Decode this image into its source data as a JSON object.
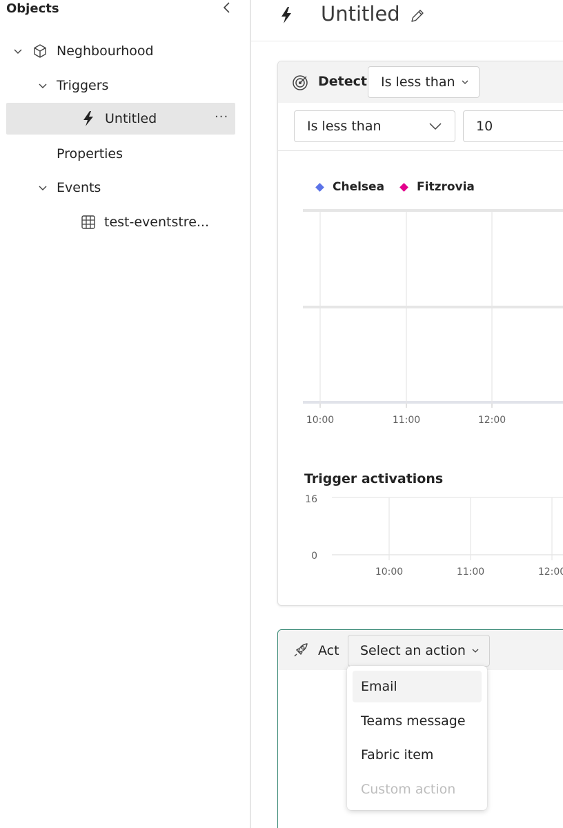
{
  "sidebar": {
    "title": "Objects",
    "tree": [
      {
        "label": "Neghbourhood"
      },
      {
        "label": "Triggers"
      },
      {
        "label": "Untitled"
      },
      {
        "label": "Properties"
      },
      {
        "label": "Events"
      },
      {
        "label": "test-eventstre..."
      }
    ],
    "more_label": "···"
  },
  "header": {
    "title": "Untitled"
  },
  "detect": {
    "label": "Detect",
    "mode": "Is less than",
    "condition": "Is less than",
    "value": "10"
  },
  "chart_data": [
    {
      "type": "line",
      "title": "",
      "x": [
        "10:00",
        "11:00",
        "12:00"
      ],
      "series": [
        {
          "name": "Chelsea",
          "color": "#5b73e8",
          "values": []
        },
        {
          "name": "Fitzrovia",
          "color": "#e3008c",
          "values": []
        }
      ],
      "grid": true,
      "legend": "top-left"
    },
    {
      "type": "line",
      "title": "Trigger activations",
      "x": [
        "10:00",
        "11:00",
        "12:00"
      ],
      "y_ticks": [
        "16",
        "0"
      ],
      "ylim": [
        0,
        16
      ],
      "series": [],
      "grid": true
    }
  ],
  "act": {
    "label": "Act",
    "select_label": "Select an action",
    "menu": [
      {
        "label": "Email",
        "state": "hover"
      },
      {
        "label": "Teams message",
        "state": "normal"
      },
      {
        "label": "Fabric item",
        "state": "normal"
      },
      {
        "label": "Custom action",
        "state": "disabled"
      }
    ]
  }
}
